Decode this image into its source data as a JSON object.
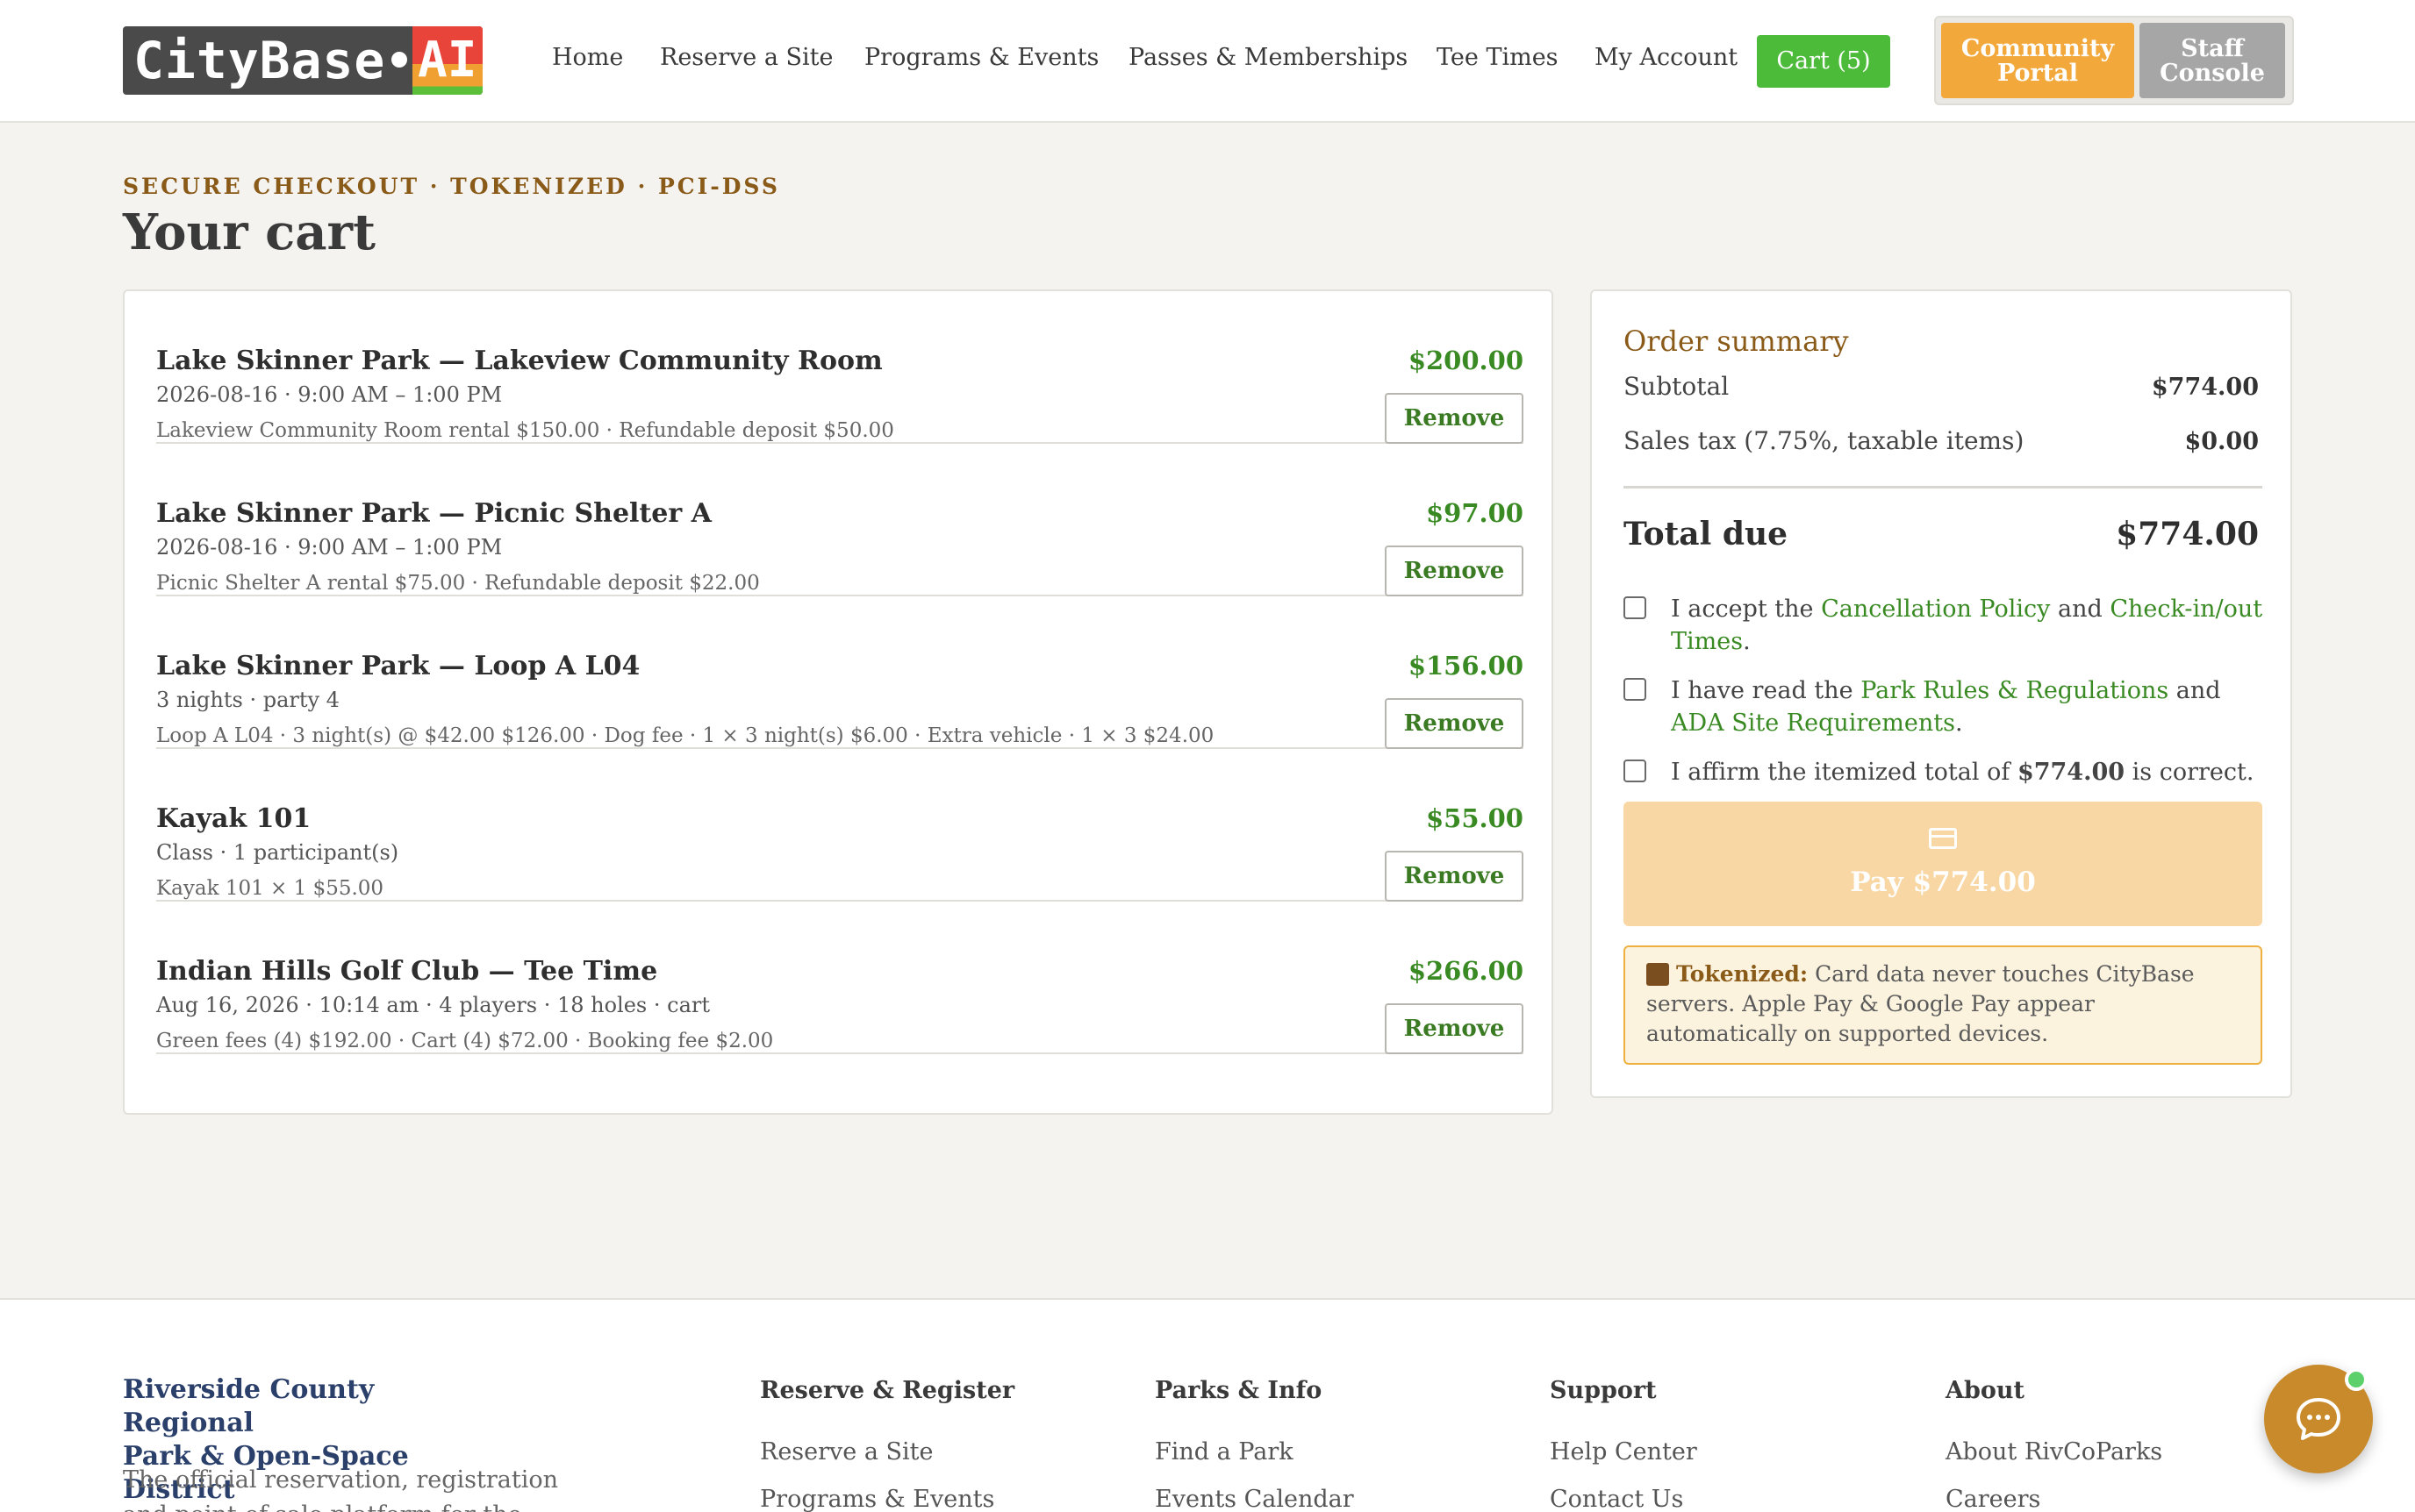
{
  "brand": {
    "logo_text": "CityBase",
    "logo_ai": "AI",
    "colors": {
      "accent_green": "#4cbb3a",
      "amber": "#f2a83a",
      "price_green": "#3a8a24",
      "brown": "#8a5a18"
    }
  },
  "nav": {
    "items": [
      {
        "label": "Home"
      },
      {
        "label": "Reserve a Site"
      },
      {
        "label": "Programs & Events"
      },
      {
        "label": "Passes & Memberships"
      },
      {
        "label": "Tee Times"
      },
      {
        "label": "My Account"
      }
    ],
    "cart_label": "Cart (5)",
    "portal_community": "Community Portal",
    "portal_staff": "Staff Console"
  },
  "page": {
    "eyebrow": "SECURE CHECKOUT · TOKENIZED · PCI-DSS",
    "title": "Your cart"
  },
  "cart": {
    "remove_label": "Remove",
    "items": [
      {
        "title": "Lake Skinner Park — Lakeview Community Room",
        "subtitle": "2026-08-16 · 9:00 AM – 1:00 PM",
        "detail": "Lakeview Community Room rental $150.00 · Refundable deposit $50.00",
        "price": "$200.00"
      },
      {
        "title": "Lake Skinner Park — Picnic Shelter A",
        "subtitle": "2026-08-16 · 9:00 AM – 1:00 PM",
        "detail": "Picnic Shelter A rental $75.00 · Refundable deposit $22.00",
        "price": "$97.00"
      },
      {
        "title": "Lake Skinner Park — Loop A L04",
        "subtitle": "3 nights · party 4",
        "detail": "Loop A L04 · 3 night(s) @ $42.00 $126.00 · Dog fee · 1 × 3 night(s) $6.00 · Extra vehicle · 1 × 3 $24.00",
        "price": "$156.00"
      },
      {
        "title": "Kayak 101",
        "subtitle": "Class · 1 participant(s)",
        "detail": "Kayak 101 × 1 $55.00",
        "price": "$55.00"
      },
      {
        "title": "Indian Hills Golf Club — Tee Time",
        "subtitle": "Aug 16, 2026 · 10:14 am · 4 players · 18 holes · cart",
        "detail": "Green fees (4) $192.00 · Cart (4) $72.00 · Booking fee $2.00",
        "price": "$266.00"
      }
    ]
  },
  "summary": {
    "title": "Order summary",
    "subtotal_label": "Subtotal",
    "subtotal_value": "$774.00",
    "tax_label": "Sales tax (7.75%, taxable items)",
    "tax_value": "$0.00",
    "total_label": "Total due",
    "total_value": "$774.00",
    "check1": {
      "prefix": "I accept the ",
      "link1": "Cancellation Policy",
      "mid": " and ",
      "link2": "Check-in/out Times",
      "suffix": "."
    },
    "check2": {
      "prefix": "I have read the ",
      "link1": "Park Rules & Regulations",
      "mid": " and ",
      "link2": "ADA Site Requirements",
      "suffix": "."
    },
    "check3": {
      "prefix": "I affirm the itemized total of ",
      "amount": "$774.00",
      "suffix": " is correct."
    },
    "pay_label": "Pay $774.00",
    "pay_icon": "credit-card-icon",
    "token_strong": "Tokenized:",
    "token_text": " Card data never touches CityBase servers. Apple Pay & Google Pay appear automatically on supported devices."
  },
  "footer": {
    "org_line1": "Riverside County Regional",
    "org_line2": "Park & Open-Space District",
    "description": "The official reservation, registration and point-of-sale platform for the Riverside",
    "columns": [
      {
        "title": "Reserve & Register",
        "links": [
          "Reserve a Site",
          "Programs & Events"
        ]
      },
      {
        "title": "Parks & Info",
        "links": [
          "Find a Park",
          "Events Calendar"
        ]
      },
      {
        "title": "Support",
        "links": [
          "Help Center",
          "Contact Us"
        ]
      },
      {
        "title": "About",
        "links": [
          "About RivCoParks",
          "Careers"
        ]
      }
    ]
  },
  "chat": {
    "icon": "chat-bubble-icon"
  }
}
